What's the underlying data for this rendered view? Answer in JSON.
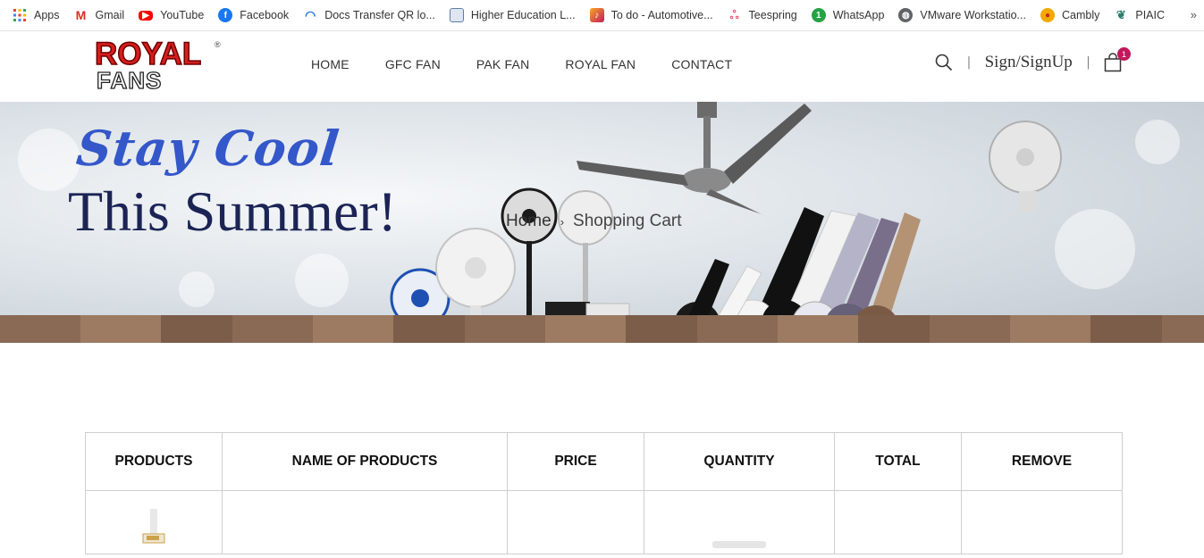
{
  "bookmarks": {
    "items": [
      {
        "label": "Apps",
        "icon": "apps-grid-icon",
        "color": "#4285f4"
      },
      {
        "label": "Gmail",
        "icon": "gmail-icon",
        "color": "#d93025"
      },
      {
        "label": "YouTube",
        "icon": "youtube-icon",
        "color": "#ff0000"
      },
      {
        "label": "Facebook",
        "icon": "facebook-icon",
        "color": "#1877f2"
      },
      {
        "label": "Docs Transfer QR lo...",
        "icon": "wifi-icon",
        "color": "#1a73e8"
      },
      {
        "label": "Higher Education L...",
        "icon": "document-icon",
        "color": "#5f7ea8"
      },
      {
        "label": "To do - Automotive...",
        "icon": "todo-icon",
        "color": "#c2185b"
      },
      {
        "label": "Teespring",
        "icon": "teespring-icon",
        "color": "#e75a7c"
      },
      {
        "label": "WhatsApp",
        "icon": "whatsapp-icon",
        "color": "#25a244"
      },
      {
        "label": "VMware Workstatio...",
        "icon": "globe-icon",
        "color": "#5f6368"
      },
      {
        "label": "Cambly",
        "icon": "cambly-icon",
        "color": "#f2a900"
      },
      {
        "label": "PIAIC",
        "icon": "piaic-icon",
        "color": "#2e7d6b"
      }
    ],
    "more": "»"
  },
  "header": {
    "logo_top": "ROYAL",
    "logo_bottom": "FANS",
    "logo_reg": "®",
    "nav": [
      "HOME",
      "GFC FAN",
      "PAK FAN",
      "ROYAL FAN",
      "CONTACT"
    ],
    "signin": "Sign/SignUp",
    "separator": "|",
    "cart_count": "1"
  },
  "hero": {
    "tagline_1": "Stay Cool",
    "tagline_2": "This Summer!",
    "breadcrumb_home": "Home",
    "breadcrumb_current": "Shopping Cart"
  },
  "cart": {
    "columns": [
      "PRODUCTS",
      "NAME OF PRODUCTS",
      "PRICE",
      "QUANTITY",
      "TOTAL",
      "REMOVE"
    ]
  },
  "colors": {
    "accent": "#c2185b",
    "logo_red": "#d71d1d",
    "tagline_blue": "#3457c9",
    "tagline_navy": "#1b2455"
  }
}
